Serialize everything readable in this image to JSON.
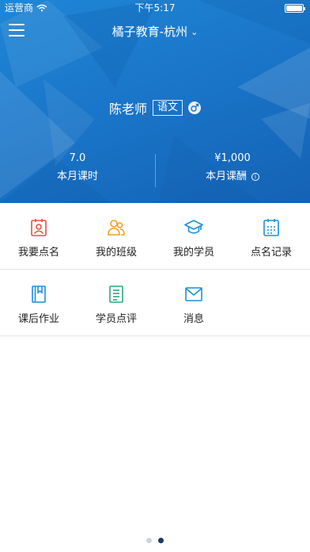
{
  "status_bar": {
    "carrier": "运营商",
    "time": "下午5:17"
  },
  "header": {
    "org_title": "橘子教育-杭州"
  },
  "teacher": {
    "name": "陈老师",
    "subject": "语文"
  },
  "stats": {
    "hours_value": "7.0",
    "hours_label": "本月课时",
    "pay_value": "¥1,000",
    "pay_label": "本月课酬"
  },
  "menu": {
    "row1": [
      {
        "label": "我要点名",
        "icon": "roll-call-icon",
        "color": "#e8503a"
      },
      {
        "label": "我的班级",
        "icon": "class-group-icon",
        "color": "#f0a020"
      },
      {
        "label": "我的学员",
        "icon": "graduation-cap-icon",
        "color": "#1a8fdc"
      },
      {
        "label": "点名记录",
        "icon": "calendar-record-icon",
        "color": "#1a8fdc"
      }
    ],
    "row2": [
      {
        "label": "课后作业",
        "icon": "homework-book-icon",
        "color": "#1a8fdc"
      },
      {
        "label": "学员点评",
        "icon": "review-note-icon",
        "color": "#2aa876"
      },
      {
        "label": "消息",
        "icon": "mail-icon",
        "color": "#1a8fdc"
      }
    ]
  },
  "pager": {
    "total": 2,
    "active_index": 1
  },
  "colors": {
    "hero_blue": "#1a76c9",
    "pager_active": "#1f3a5f",
    "divider": "#e6e6e6"
  }
}
